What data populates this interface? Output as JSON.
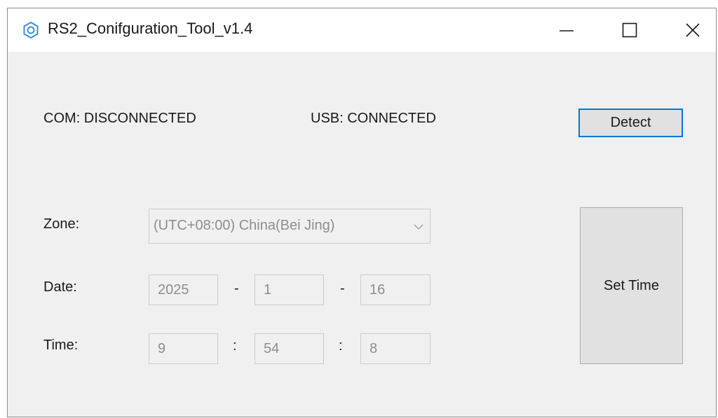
{
  "window": {
    "title": "RS2_Conifguration_Tool_v1.4"
  },
  "status": {
    "com": "COM: DISCONNECTED",
    "usb": "USB: CONNECTED",
    "detect_label": "Detect"
  },
  "zone": {
    "label": "Zone:",
    "selected": "(UTC+08:00) China(Bei Jing)"
  },
  "date": {
    "label": "Date:",
    "year": "2025",
    "month": "1",
    "day": "16",
    "sep": "-"
  },
  "time": {
    "label": "Time:",
    "hour": "9",
    "minute": "54",
    "second": "8",
    "sep": ":"
  },
  "actions": {
    "set_time_label": "Set Time"
  },
  "icons": {
    "app": "gear-icon",
    "minimize": "minimize-icon",
    "maximize": "maximize-icon",
    "close": "close-icon",
    "dropdown": "chevron-down-icon"
  },
  "colors": {
    "accent": "#0078d7",
    "disabled_text": "#8e8e8e",
    "window_bg": "#f0f0f0"
  }
}
